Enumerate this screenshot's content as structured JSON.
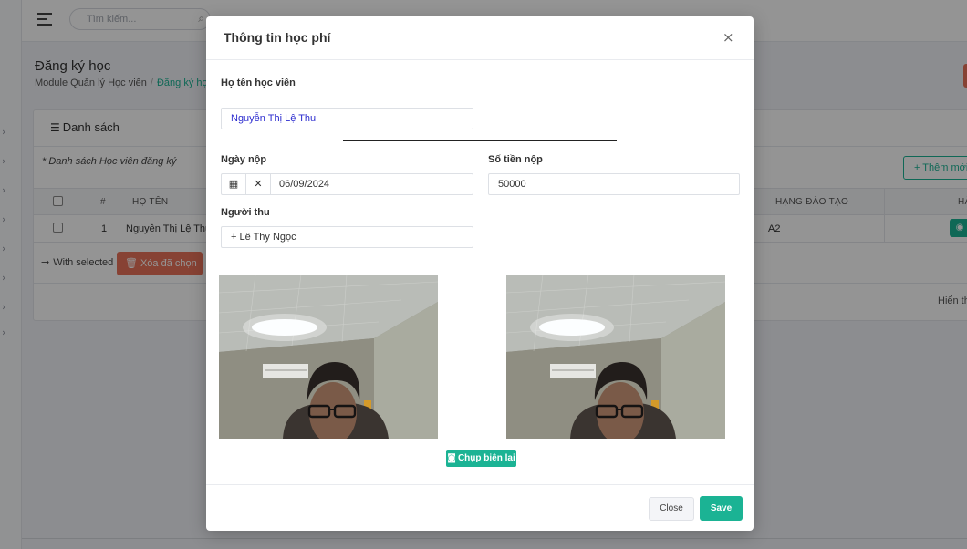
{
  "header": {
    "search_placeholder": "Tìm kiếm..."
  },
  "page": {
    "title": "Đăng ký học",
    "breadcrumb": {
      "module": "Module Quản lý Học viên",
      "current": "Đăng ký học"
    }
  },
  "list": {
    "title": "Danh sách",
    "note": "* Danh sách Học viên đăng ký",
    "add_button": "+ Thêm mới",
    "columns": {
      "index": "#",
      "name": "HỌ TÊN",
      "level": "HẠNG ĐÀO TẠO",
      "actions": "HÀ"
    },
    "rows": [
      {
        "index": "1",
        "name": "Nguyễn Thị Lệ Thu",
        "level": "A2"
      }
    ],
    "with_selected": "With selected",
    "delete_selected": "Xóa đã chọn",
    "paging": "Hiển th"
  },
  "modal": {
    "title": "Thông tin học phí",
    "close_icon": "×",
    "student_label": "Họ tên học viên",
    "student_value": "Nguyễn Thị Lệ Thu",
    "date_label": "Ngày nộp",
    "date_value": "06/09/2024",
    "amount_label": "Số tiền nộp",
    "amount_value": "50000",
    "receiver_label": "Người thu",
    "receiver_value": "+ Lê Thy Ngọc",
    "capture_button": "Chụp biên lai",
    "close_button": "Close",
    "save_button": "Save"
  },
  "icons": {
    "menu": "hamburger-icon",
    "search": "search-icon",
    "list": "list-icon",
    "calendar": "calendar-icon",
    "clear": "close-icon",
    "camera": "camera-icon",
    "trash": "trash-icon",
    "eye": "eye-icon",
    "arrow": "arrow-right-icon"
  },
  "colors": {
    "accent": "#1bb394",
    "danger": "#e9735b",
    "input_text_blue": "#2c2ccf"
  }
}
